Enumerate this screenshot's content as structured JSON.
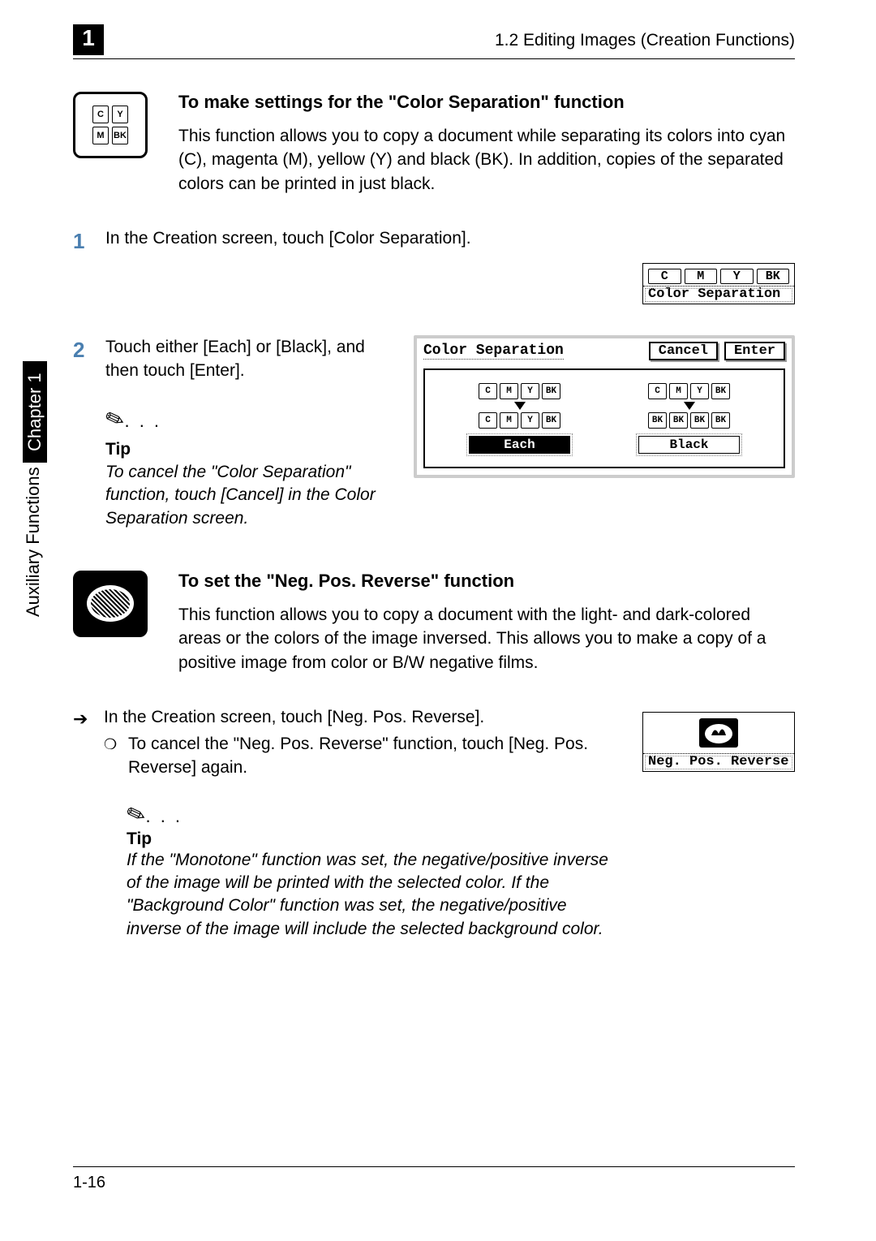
{
  "header": {
    "chapter_tab": "1",
    "breadcrumb": "1.2 Editing Images (Creation Functions)"
  },
  "side": {
    "functions": "Auxiliary Functions",
    "chapter": "Chapter 1"
  },
  "section1": {
    "heading": "To make settings for the \"Color Separation\" function",
    "para": "This function allows you to copy a document while separating its colors into cyan (C), magenta (M), yellow (Y) and black (BK). In addition, copies of the separated colors can be printed in just black.",
    "step1_num": "1",
    "step1_text": "In the Creation screen, touch [Color Separation].",
    "illus_small_cells": [
      "C",
      "M",
      "Y",
      "BK"
    ],
    "illus_small_label": "Color Separation",
    "step2_num": "2",
    "step2_text": "Touch either [Each] or [Black], and then touch [Enter].",
    "panel": {
      "title": "Color Separation",
      "cancel": "Cancel",
      "enter": "Enter",
      "each_cells_top": [
        "C",
        "M",
        "Y",
        "BK"
      ],
      "each_cells_bot": [
        "C",
        "M",
        "Y",
        "BK"
      ],
      "each_label": "Each",
      "black_cells_top": [
        "C",
        "M",
        "Y",
        "BK"
      ],
      "black_cells_bot": [
        "BK",
        "BK",
        "BK",
        "BK"
      ],
      "black_label": "Black"
    },
    "tip_head": "Tip",
    "tip_text": "To cancel the \"Color Separation\" function, touch [Cancel] in the Color Separation screen."
  },
  "section2": {
    "heading": "To set the \"Neg. Pos. Reverse\" function",
    "para": "This function allows you to copy a document with the light- and dark-colored areas or the colors of the image inversed. This allows you to make a copy of a positive image from color or B/W negative films.",
    "bullet_text": "In the Creation screen, touch [Neg. Pos. Reverse].",
    "sub_text": "To cancel the \"Neg. Pos. Reverse\" function, touch [Neg. Pos. Reverse] again.",
    "illus_label": "Neg. Pos. Reverse",
    "tip_head": "Tip",
    "tip_text": "If the \"Monotone\" function was set, the negative/positive inverse of the image will be printed with the selected color. If the \"Background Color\" function was set, the negative/positive inverse of the image will include the selected background color."
  },
  "footer": {
    "page": "1-16"
  },
  "icon_cells": {
    "r1": [
      "C",
      "Y"
    ],
    "r2": [
      "M",
      "BK"
    ]
  }
}
